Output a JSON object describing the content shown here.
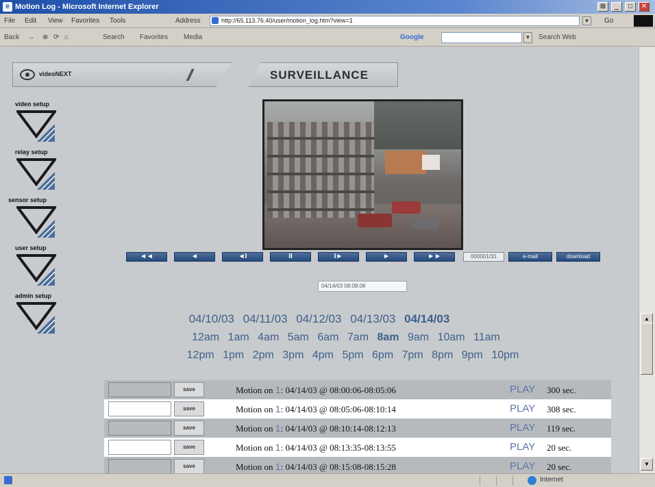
{
  "window": {
    "title": "Motion Log - Microsoft Internet Explorer"
  },
  "menu": [
    "File",
    "Edit",
    "View",
    "Favorites",
    "Tools"
  ],
  "address": {
    "label": "Address",
    "url": "http://65.113.76.40/user/motion_log.htm?view=1",
    "go": "Go"
  },
  "toolbar": {
    "back": "Back",
    "search": "Search",
    "favorites": "Favorites",
    "media": "Media",
    "google": "Google",
    "search_web": "Search Web"
  },
  "header": {
    "logo_text": "videoNEXT",
    "title": "SURVEILLANCE"
  },
  "sidebar": [
    {
      "label": "video setup"
    },
    {
      "label": "relay setup"
    },
    {
      "label": "sensor setup"
    },
    {
      "label": "user setup"
    },
    {
      "label": "admin setup"
    }
  ],
  "player": {
    "controls": [
      "◄◄",
      "◄",
      "◄I",
      "II",
      "I►",
      "►",
      "►►"
    ],
    "frame_counter": "000001/31",
    "email_label": "e-mail",
    "download_label": "download",
    "timestamp": "04/14/03 08:08:06"
  },
  "dates": [
    "04/10/03",
    "04/11/03",
    "04/12/03",
    "04/13/03",
    "04/14/03"
  ],
  "selected_date": "04/14/03",
  "hours_am": [
    "12am",
    "1am",
    "4am",
    "5am",
    "6am",
    "7am",
    "8am",
    "9am",
    "10am",
    "11am"
  ],
  "selected_hour": "8am",
  "hours_pm": [
    "12pm",
    "1pm",
    "2pm",
    "3pm",
    "4pm",
    "5pm",
    "6pm",
    "7pm",
    "8pm",
    "9pm",
    "10pm"
  ],
  "log": {
    "save_label": "save",
    "motion_prefix": "Motion on",
    "play_label": "PLAY",
    "rows": [
      {
        "camera": "1",
        "range": ": 04/14/03 @ 08:00:06-08:05:06",
        "duration": "300 sec."
      },
      {
        "camera": "1",
        "range": ": 04/14/03 @ 08:05:06-08:10:14",
        "duration": "308 sec."
      },
      {
        "camera": "1",
        "range": ": 04/14/03 @ 08:10:14-08:12:13",
        "duration": "119 sec."
      },
      {
        "camera": "1",
        "range": ": 04/14/03 @ 08:13:35-08:13:55",
        "duration": "20 sec."
      },
      {
        "camera": "1",
        "range": ": 04/14/03 @ 08:15:08-08:15:28",
        "duration": "20 sec."
      }
    ]
  },
  "status": {
    "zone": "Internet"
  },
  "colors": {
    "accent_link": "#3d5f8c",
    "control_blue": "#254a7c",
    "title_blue": "#1f4fa8"
  }
}
